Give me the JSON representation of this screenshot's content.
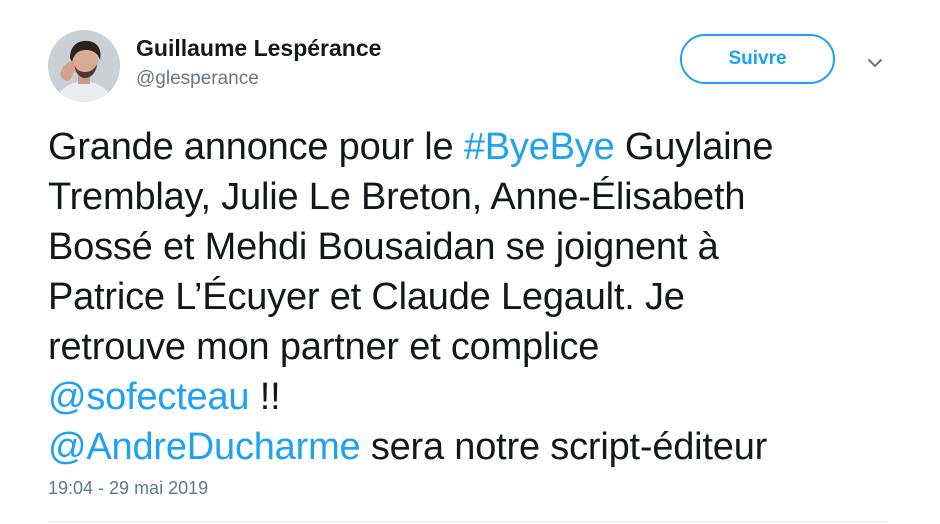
{
  "author": {
    "name": "Guillaume Lespérance",
    "handle": "@glesperance"
  },
  "follow_button": {
    "label": "Suivre"
  },
  "tweet": {
    "line1": {
      "before": "Grande annonce pour le ",
      "hashtag": "#ByeBye",
      "after": " Guylaine"
    },
    "line2": "Tremblay, Julie Le Breton, Anne-Élisabeth",
    "line3": "Bossé et Mehdi Bousaidan se joignent à",
    "line4": "Patrice L’Écuyer et Claude Legault. Je",
    "line5": "retrouve mon partner et complice",
    "line6": {
      "mention": "@sofecteau",
      "after": " !!"
    },
    "line7": {
      "mention": "@AndreDucharme",
      "after": " sera notre script-éditeur"
    }
  },
  "timestamp": "19:04 - 29 mai 2019",
  "colors": {
    "link": "#1da1f2",
    "text": "#14171a",
    "secondary": "#657786"
  },
  "icons": {
    "avatar": "profile-photo",
    "caret": "chevron-down-icon"
  }
}
